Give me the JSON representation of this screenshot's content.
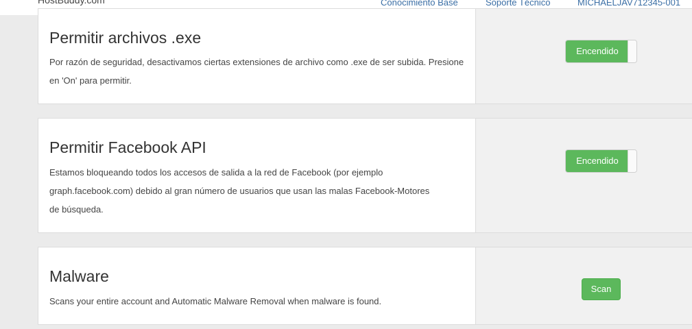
{
  "header": {
    "brand": "HostBuddy.com",
    "nav": [
      "Conocimiento Base",
      "Soporte Técnico",
      "MICHAELJAV712345-001"
    ]
  },
  "settings": [
    {
      "title": "Permitir archivos .exe",
      "description": "Por razón de seguridad, desactivamos ciertas extensiones de archivo como .exe de ser subida. Presione en 'On' para permitir.",
      "control": "Encendido"
    },
    {
      "title": "Permitir Facebook API",
      "description": "Estamos bloqueando todos los accesos de salida a la red de Facebook (por ejemplo graph.facebook.com) debido al gran número de usuarios que usan las malas Facebook-Motores de búsqueda.",
      "control": "Encendido"
    },
    {
      "title": "Malware",
      "description": "Scans your entire account and Automatic Malware Removal when malware is found.",
      "control": "Scan"
    }
  ],
  "colors": {
    "accent_green": "#5cb85c",
    "link": "#3a6ea5",
    "background": "#ebebeb"
  }
}
